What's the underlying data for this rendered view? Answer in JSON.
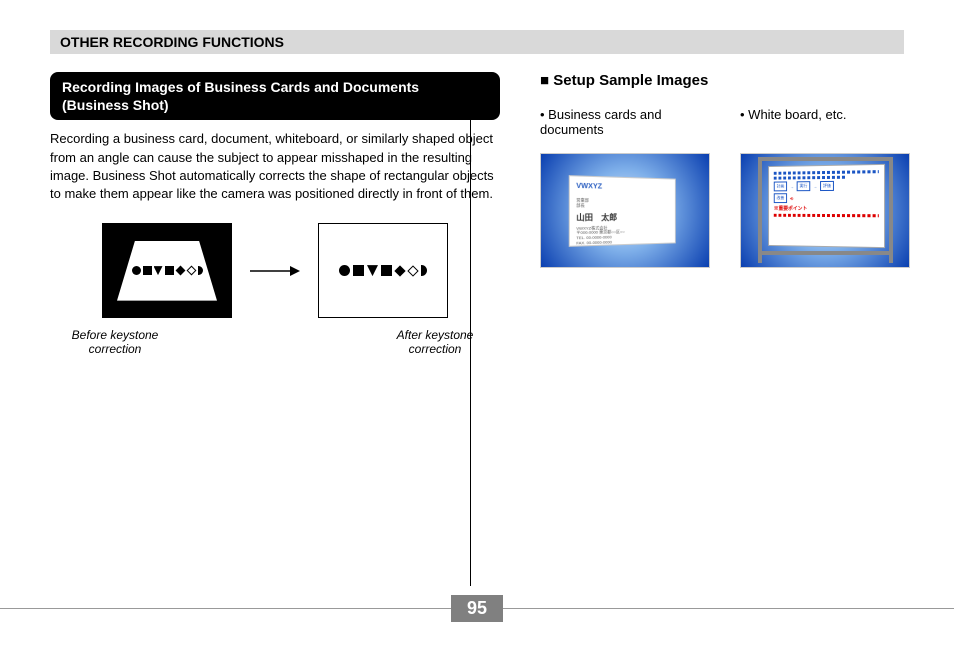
{
  "header": "OTHER RECORDING FUNCTIONS",
  "left": {
    "heading": "Recording Images of Business Cards and Documents (Business Shot)",
    "body": "Recording a business card, document, whiteboard, or similarly shaped object from an angle can cause the subject to appear misshaped in the resulting image. Business Shot automatically corrects the shape of rectangular objects to make them appear like the camera was positioned directly in front of them.",
    "caption_before": "Before keystone correction",
    "caption_after": "After keystone correction"
  },
  "right": {
    "heading": "Setup Sample Images",
    "sample1_label": "Business cards and documents",
    "sample2_label": "White board, etc.",
    "card": {
      "logo": "VWXYZ",
      "name": "山田　太郎",
      "company": "VWXYZ株式会社",
      "address": "〒000-0000 東京都○○区○○",
      "tel": "TEL. 00-0000-0000",
      "fax": "FAX. 00-0000-0000"
    }
  },
  "page_number": "95",
  "square_marker": "■ "
}
